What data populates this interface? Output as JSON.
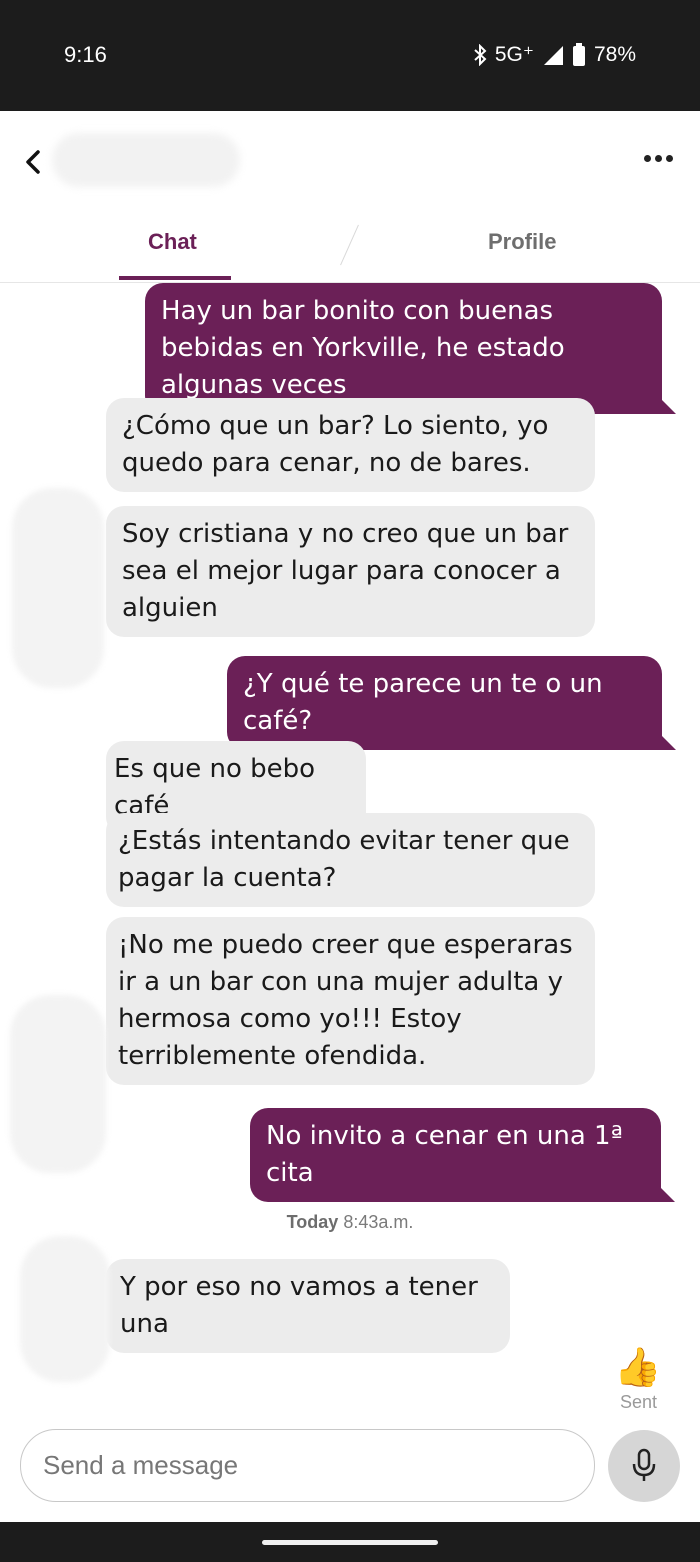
{
  "status_bar": {
    "time": "9:16",
    "network": "5G⁺",
    "battery": "78%",
    "icons": [
      "bluetooth-icon",
      "signal-icon",
      "battery-icon"
    ]
  },
  "header": {
    "tabs": [
      {
        "label": "Chat",
        "active": true
      },
      {
        "label": "Profile",
        "active": false
      }
    ]
  },
  "messages": [
    {
      "direction": "out",
      "text": "Hay un bar bonito con buenas bebidas en Yorkville, he estado algunas veces"
    },
    {
      "direction": "in",
      "text": "¿Cómo que un bar? Lo siento, yo quedo para cenar, no de bares."
    },
    {
      "direction": "in",
      "text": "Soy cristiana y no creo que un bar sea el mejor lugar para conocer a alguien"
    },
    {
      "direction": "out",
      "text": "¿Y qué te parece un te o un café?"
    },
    {
      "direction": "in",
      "text": "Es que no bebo café"
    },
    {
      "direction": "in",
      "text": "¿Estás intentando evitar tener que pagar la cuenta?"
    },
    {
      "direction": "in",
      "text": "¡No me puedo creer que esperaras ir a un bar con una mujer adulta y hermosa como yo!!! Estoy terriblemente ofendida."
    },
    {
      "direction": "out",
      "text": "No invito a cenar en una 1ª cita"
    },
    {
      "direction": "in",
      "text": "Y por eso no vamos a tener una"
    }
  ],
  "timestamp": {
    "day": "Today",
    "time": "8:43a.m."
  },
  "sent_reaction": {
    "emoji": "👍",
    "label": "Sent"
  },
  "composer": {
    "placeholder": "Send a message"
  },
  "colors": {
    "accent": "#6b2057",
    "incoming_bubble": "#ececec"
  }
}
